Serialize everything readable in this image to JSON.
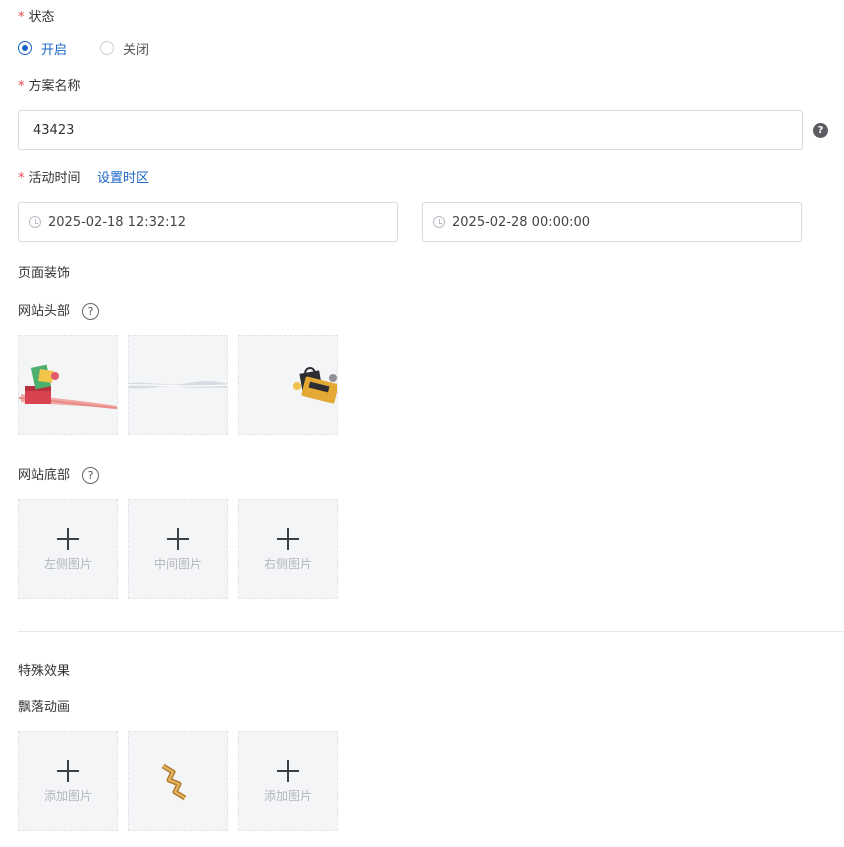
{
  "status": {
    "label": "状态",
    "required_mark": "*",
    "options": [
      {
        "label": "开启",
        "selected": true
      },
      {
        "label": "关闭",
        "selected": false
      }
    ]
  },
  "plan_name": {
    "label": "方案名称",
    "required_mark": "*",
    "value": "43423",
    "help_icon": "question-icon"
  },
  "activity_time": {
    "label": "活动时间",
    "required_mark": "*",
    "timezone_link": "设置时区",
    "start": "2025-02-18 12:32:12",
    "end": "2025-02-28 00:00:00"
  },
  "page_decoration": {
    "heading": "页面装饰",
    "site_header": {
      "label": "网站头部",
      "images": [
        "gift-box-ribbon-image",
        "silver-ribbon-image",
        "discount-shopping-bag-image"
      ]
    },
    "site_footer": {
      "label": "网站底部",
      "upload_slots": [
        "左侧图片",
        "中间图片",
        "右侧图片"
      ]
    }
  },
  "special_effects": {
    "heading": "特殊效果",
    "falling_animation": {
      "label": "飘落动画",
      "slot_left": "添加图片",
      "slot_middle_image": "gold-ribbon-image",
      "slot_right": "添加图片"
    }
  },
  "colors": {
    "accent": "#1a66c8",
    "required": "#e5484d",
    "tile_bg": "#f4f5f7",
    "border": "#d9dbe0"
  }
}
